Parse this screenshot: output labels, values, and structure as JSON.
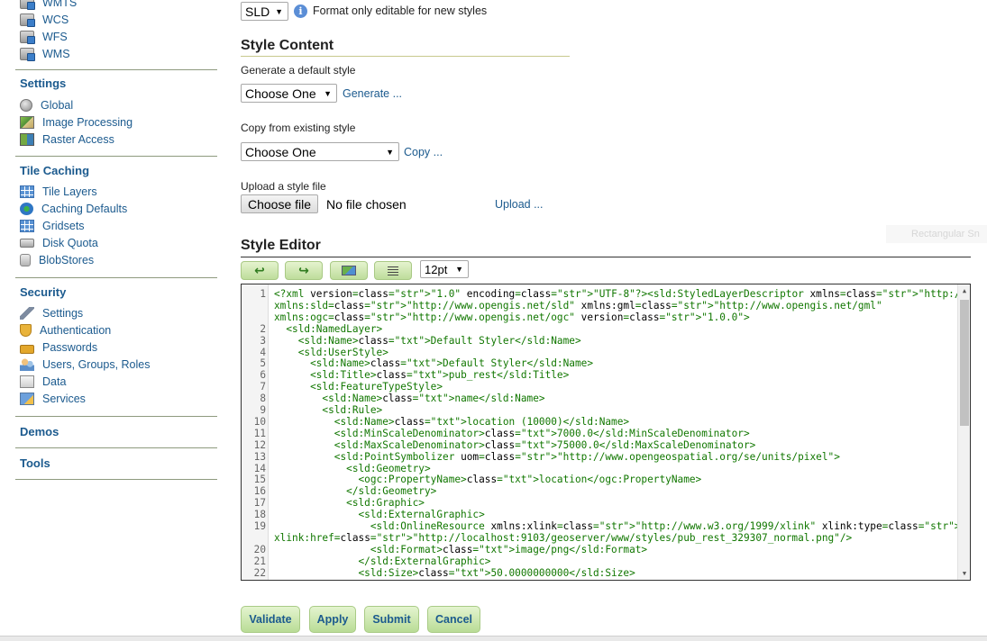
{
  "sidebar": {
    "services_items": [
      {
        "label": "WMTS",
        "icon": "server-icon"
      },
      {
        "label": "WCS",
        "icon": "server-icon"
      },
      {
        "label": "WFS",
        "icon": "server-icon"
      },
      {
        "label": "WMS",
        "icon": "server-icon"
      }
    ],
    "settings": {
      "title": "Settings",
      "items": [
        {
          "label": "Global",
          "icon": "globe-icon"
        },
        {
          "label": "Image Processing",
          "icon": "image-icon"
        },
        {
          "label": "Raster Access",
          "icon": "raster-icon"
        }
      ]
    },
    "tile_caching": {
      "title": "Tile Caching",
      "items": [
        {
          "label": "Tile Layers",
          "icon": "grid-icon"
        },
        {
          "label": "Caching Defaults",
          "icon": "cache-icon"
        },
        {
          "label": "Gridsets",
          "icon": "grid-icon"
        },
        {
          "label": "Disk Quota",
          "icon": "disk-icon"
        },
        {
          "label": "BlobStores",
          "icon": "blob-icon"
        }
      ]
    },
    "security": {
      "title": "Security",
      "items": [
        {
          "label": "Settings",
          "icon": "wrench-icon"
        },
        {
          "label": "Authentication",
          "icon": "shield-icon"
        },
        {
          "label": "Passwords",
          "icon": "lock-icon"
        },
        {
          "label": "Users, Groups, Roles",
          "icon": "users-icon"
        },
        {
          "label": "Data",
          "icon": "data-icon"
        },
        {
          "label": "Services",
          "icon": "services-icon"
        }
      ]
    },
    "demos": {
      "title": "Demos"
    },
    "tools": {
      "title": "Tools"
    }
  },
  "format": {
    "selected": "SLD",
    "note": "Format only editable for new styles"
  },
  "style_content": {
    "title": "Style Content",
    "generate_label": "Generate a default style",
    "generate_select": "Choose One",
    "generate_link": "Generate ...",
    "copy_label": "Copy from existing style",
    "copy_select": "Choose One",
    "copy_link": "Copy ...",
    "upload_label": "Upload a style file",
    "choose_file": "Choose file",
    "no_file": "No file chosen",
    "upload_link": "Upload ..."
  },
  "style_editor": {
    "title": "Style Editor",
    "font_size": "12pt",
    "lines": [
      {
        "n": "1",
        "text": "<?xml version=\"1.0\" encoding=\"UTF-8\"?><sld:StyledLayerDescriptor xmlns=\"http://www.opengis.net/sld\""
      },
      {
        "n": "",
        "text": "xmlns:sld=\"http://www.opengis.net/sld\" xmlns:gml=\"http://www.opengis.net/gml\""
      },
      {
        "n": "",
        "text": "xmlns:ogc=\"http://www.opengis.net/ogc\" version=\"1.0.0\">"
      },
      {
        "n": "2",
        "text": "  <sld:NamedLayer>"
      },
      {
        "n": "3",
        "text": "    <sld:Name>Default Styler</sld:Name>"
      },
      {
        "n": "4",
        "text": "    <sld:UserStyle>"
      },
      {
        "n": "5",
        "text": "      <sld:Name>Default Styler</sld:Name>"
      },
      {
        "n": "6",
        "text": "      <sld:Title>pub_rest</sld:Title>"
      },
      {
        "n": "7",
        "text": "      <sld:FeatureTypeStyle>"
      },
      {
        "n": "8",
        "text": "        <sld:Name>name</sld:Name>"
      },
      {
        "n": "9",
        "text": "        <sld:Rule>"
      },
      {
        "n": "10",
        "text": "          <sld:Name>location (10000)</sld:Name>"
      },
      {
        "n": "11",
        "text": "          <sld:MinScaleDenominator>7000.0</sld:MinScaleDenominator>"
      },
      {
        "n": "12",
        "text": "          <sld:MaxScaleDenominator>75000.0</sld:MaxScaleDenominator>"
      },
      {
        "n": "13",
        "text": "          <sld:PointSymbolizer uom=\"http://www.opengeospatial.org/se/units/pixel\">"
      },
      {
        "n": "14",
        "text": "            <sld:Geometry>"
      },
      {
        "n": "15",
        "text": "              <ogc:PropertyName>location</ogc:PropertyName>"
      },
      {
        "n": "16",
        "text": "            </sld:Geometry>"
      },
      {
        "n": "17",
        "text": "            <sld:Graphic>"
      },
      {
        "n": "18",
        "text": "              <sld:ExternalGraphic>"
      },
      {
        "n": "19",
        "text": "                <sld:OnlineResource xmlns:xlink=\"http://www.w3.org/1999/xlink\" xlink:type=\"simple\""
      },
      {
        "n": "",
        "text": "xlink:href=\"http://localhost:9103/geoserver/www/styles/pub_rest_329307_normal.png\"/>"
      },
      {
        "n": "20",
        "text": "                <sld:Format>image/png</sld:Format>"
      },
      {
        "n": "21",
        "text": "              </sld:ExternalGraphic>"
      },
      {
        "n": "22",
        "text": "              <sld:Size>50.0000000000</sld:Size>"
      }
    ]
  },
  "actions": {
    "validate": "Validate",
    "apply": "Apply",
    "submit": "Submit",
    "cancel": "Cancel"
  },
  "ghost_text": "Rectangular Sn"
}
